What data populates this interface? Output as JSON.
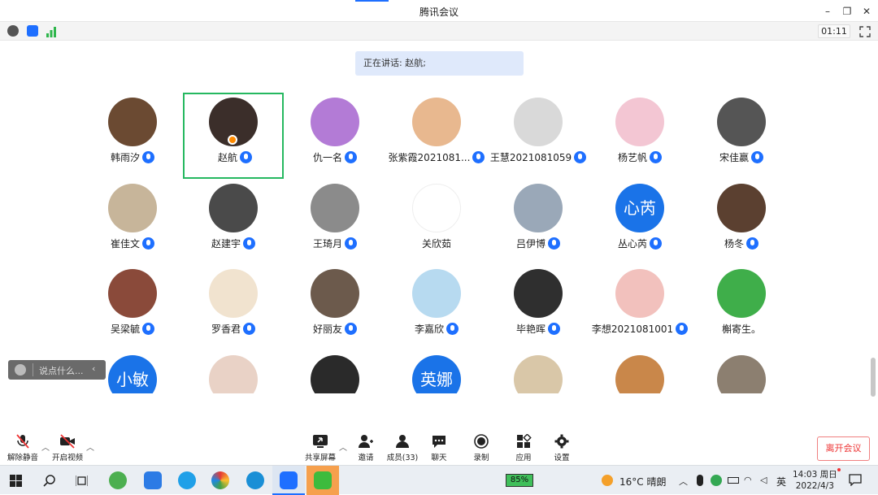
{
  "window": {
    "title": "腾讯会议"
  },
  "status": {
    "timer": "01:11"
  },
  "speaking": {
    "text": "正在讲话: 赵航;"
  },
  "participants": [
    {
      "name": "韩雨汐",
      "avatar": "bear-photo",
      "mic": true
    },
    {
      "name": "赵航",
      "avatar": "selfie-photo",
      "mic": true,
      "active": true
    },
    {
      "name": "仇一名",
      "avatar": "cartoon-photo",
      "mic": true
    },
    {
      "name": "张紫霞2021081...",
      "avatar": "anime-photo",
      "mic": true
    },
    {
      "name": "王慧2021081059",
      "avatar": "sketch-photo",
      "mic": true
    },
    {
      "name": "杨艺帆",
      "avatar": "doll-photo",
      "mic": true
    },
    {
      "name": "宋佳赢",
      "avatar": "dog-photo",
      "mic": true
    },
    {
      "name": "崔佳文",
      "avatar": "drawing-photo",
      "mic": true
    },
    {
      "name": "赵建宇",
      "avatar": "people-photo",
      "mic": true
    },
    {
      "name": "王琦月",
      "avatar": "beach-photo",
      "mic": true
    },
    {
      "name": "关欣茹",
      "avatar": "emoji-photo",
      "mic": false
    },
    {
      "name": "吕伊博",
      "avatar": "sky-photo",
      "mic": true
    },
    {
      "name": "丛心芮",
      "avatar_text": "心芮",
      "mic": true
    },
    {
      "name": "杨冬",
      "avatar": "teddy-photo",
      "mic": true
    },
    {
      "name": "吴梁毓",
      "avatar": "anime2-photo",
      "mic": true
    },
    {
      "name": "罗香君",
      "avatar": "illustration-photo",
      "mic": true
    },
    {
      "name": "好丽友",
      "avatar": "cap-photo",
      "mic": true
    },
    {
      "name": "李嘉欣",
      "avatar": "sheep-photo",
      "mic": true
    },
    {
      "name": "毕艳晖",
      "avatar": "girl-photo",
      "mic": true
    },
    {
      "name": "李想2021081001",
      "avatar": "painting-photo",
      "mic": true
    },
    {
      "name": "槲寄生。",
      "avatar": "cartoon-boy-photo",
      "mic": false
    },
    {
      "name": "",
      "avatar_text": "小敏",
      "mic": false
    },
    {
      "name": "",
      "avatar": "child-photo",
      "mic": false
    },
    {
      "name": "",
      "avatar": "dark-photo",
      "mic": false
    },
    {
      "name": "",
      "avatar_text": "英娜",
      "mic": false
    },
    {
      "name": "",
      "avatar": "cats-photo",
      "mic": false
    },
    {
      "name": "",
      "avatar": "sunset-photo",
      "mic": false
    },
    {
      "name": "",
      "avatar": "room-photo",
      "mic": false
    }
  ],
  "chat": {
    "placeholder": "说点什么..."
  },
  "toolbar": {
    "unmute": "解除静音",
    "video": "开启视频",
    "share": "共享屏幕",
    "invite": "邀请",
    "members": "成员(33)",
    "chat": "聊天",
    "record": "录制",
    "apps": "应用",
    "settings": "设置",
    "leave": "离开会议"
  },
  "taskbar": {
    "battery": "85%",
    "weather": "16°C  晴朗",
    "ime": "英",
    "time": "14:03 周日",
    "date": "2022/4/3"
  },
  "colors": {
    "accent": "#1e6fff",
    "active_border": "#25b860",
    "leave": "#e33333"
  }
}
